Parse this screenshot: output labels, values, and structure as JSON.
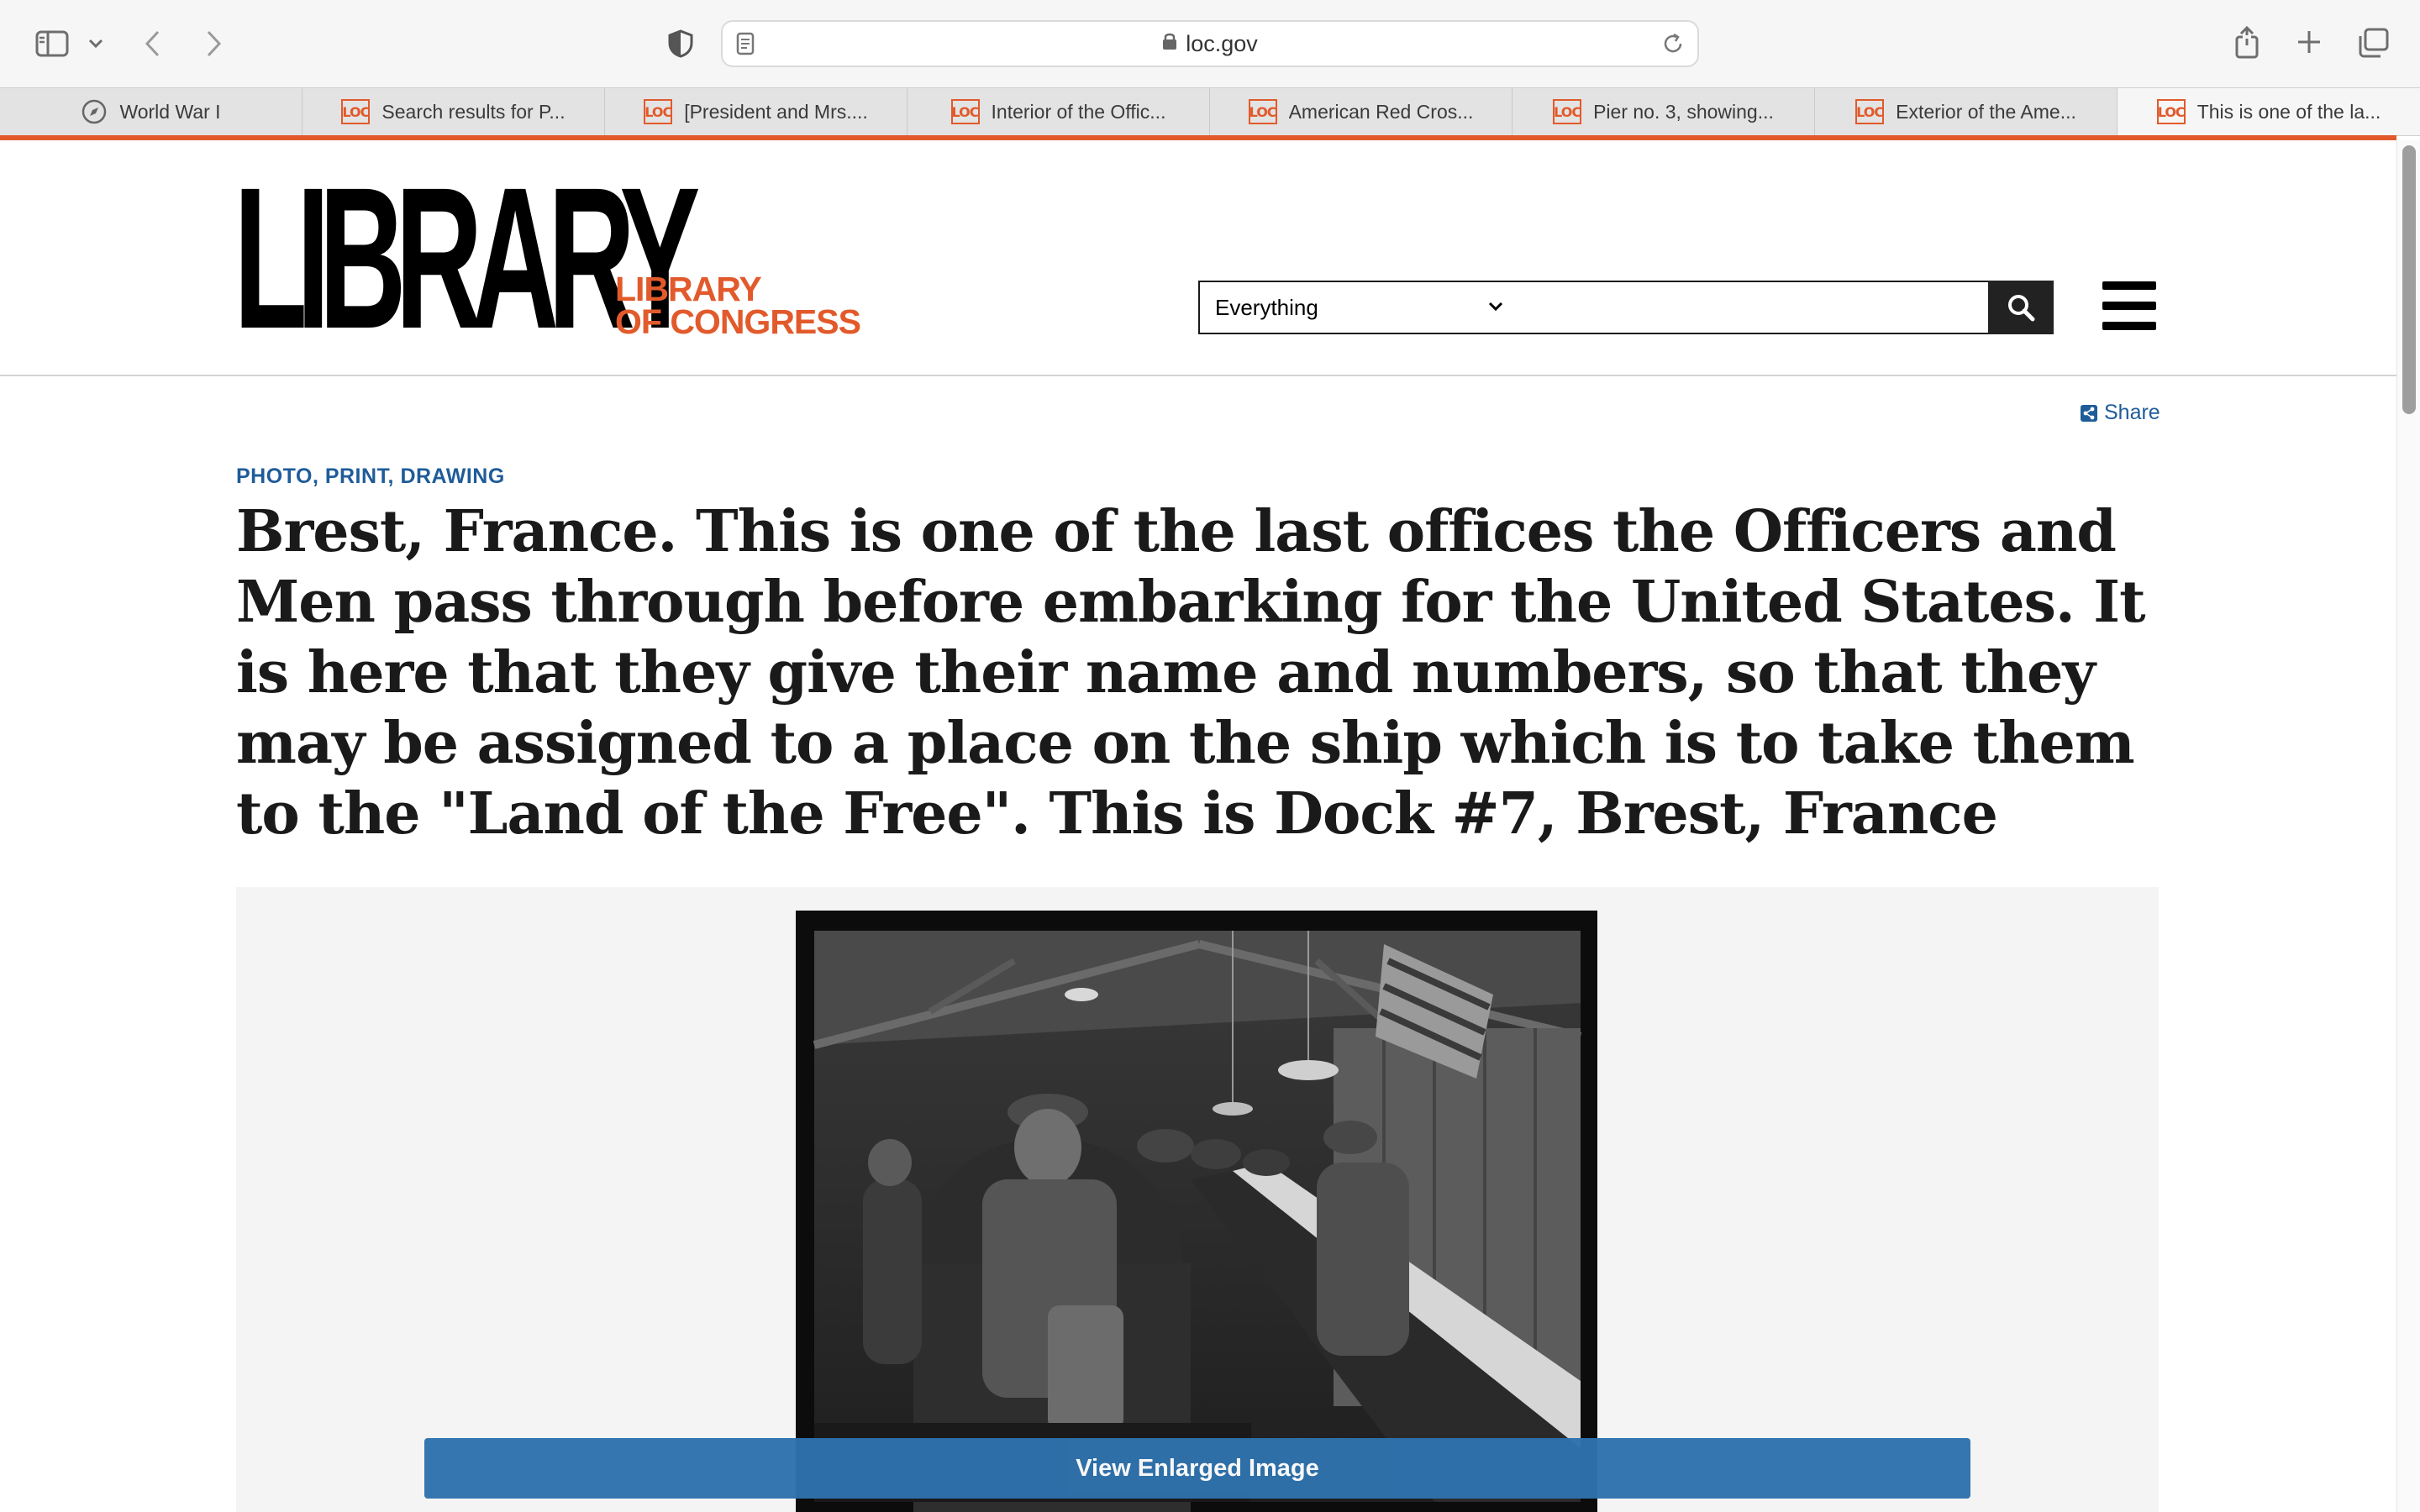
{
  "browser": {
    "url": "loc.gov",
    "tabs": [
      {
        "label": "World War I",
        "favicon": "compass-icon"
      },
      {
        "label": "Search results for P...",
        "favicon": "loc-icon"
      },
      {
        "label": "[President and Mrs....",
        "favicon": "loc-icon"
      },
      {
        "label": "Interior of the Offic...",
        "favicon": "loc-icon"
      },
      {
        "label": "American Red Cros...",
        "favicon": "loc-icon"
      },
      {
        "label": "Pier no. 3, showing...",
        "favicon": "loc-icon"
      },
      {
        "label": "Exterior of the Ame...",
        "favicon": "loc-icon"
      },
      {
        "label": "This is one of the la...",
        "favicon": "loc-icon",
        "active": true
      }
    ],
    "favicon_text": "LOC"
  },
  "header": {
    "logo_main": "LIBRARY",
    "logo_sub_line1": "LIBRARY",
    "logo_sub_line2": "OF CONGRESS",
    "search_scope": "Everything",
    "search_value": "",
    "accent_color": "#e25a2b"
  },
  "content": {
    "share_label": "Share",
    "category": "PHOTO, PRINT, DRAWING",
    "title": "Brest, France. This is one of the last offices the Officers and Men pass through before embarking for the United States. It is here that they give their name and numbers, so that they may be assigned to a place on the ship which is to take them to the \"Land of the Free\". This is Dock #7, Brest, France",
    "enlarge_label": "View Enlarged Image",
    "link_color": "#1f5c99",
    "button_color": "#2f72ad"
  }
}
